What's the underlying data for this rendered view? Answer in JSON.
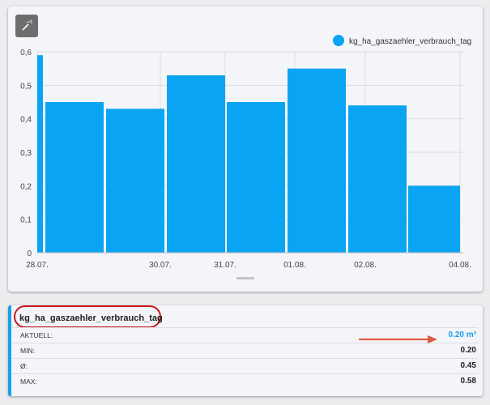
{
  "toolbar": {
    "wand_icon": "magic-wand-icon"
  },
  "chart_data": {
    "type": "bar",
    "series": [
      {
        "name": "kg_ha_gaszaehler_verbrauch_tag",
        "values": [
          0.59,
          0.45,
          0.43,
          0.53,
          0.45,
          0.55,
          0.44,
          0.2
        ]
      }
    ],
    "x_labels": [
      "28.07.",
      "30.07.",
      "31.07.",
      "01.08.",
      "02.08.",
      "04.08."
    ],
    "y_ticks": [
      "0",
      "0,1",
      "0,2",
      "0,3",
      "0,4",
      "0,5",
      "0,6"
    ],
    "ylim": [
      0,
      0.6
    ],
    "grid": true,
    "legend": "top-right",
    "color": "#0aa5f2"
  },
  "stats": {
    "title": "kg_ha_gaszaehler_verbrauch_tag",
    "rows": [
      {
        "label": "AKTUELL:",
        "value": "0.20 m³"
      },
      {
        "label": "MIN:",
        "value": "0.20"
      },
      {
        "label": "Ø:",
        "value": "0.45"
      },
      {
        "label": "MAX:",
        "value": "0.58"
      }
    ]
  },
  "colors": {
    "accent": "#19a1e6",
    "annotation": "#c8191c",
    "arrow": "#e05a45"
  }
}
